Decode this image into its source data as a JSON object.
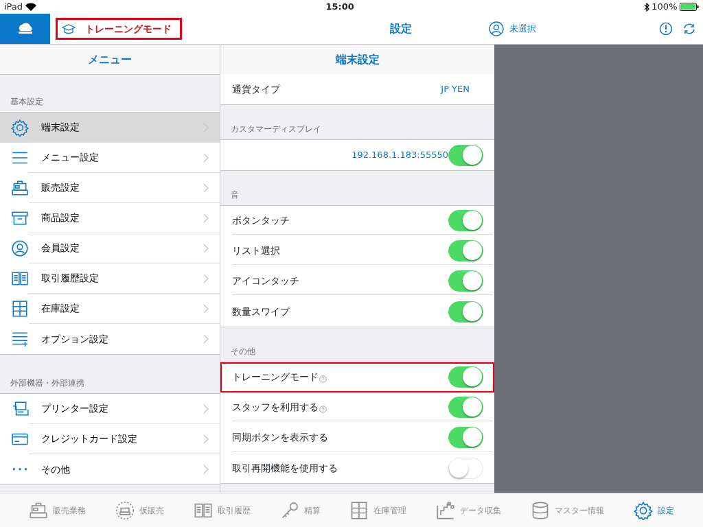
{
  "status_bar": {
    "device": "iPad",
    "time": "15:00",
    "battery": "100%"
  },
  "header": {
    "training_mode": {
      "label": "トレーニングモード",
      "highlighted": true
    },
    "title": "設定",
    "user": "未選択"
  },
  "menu": {
    "title": "メニュー",
    "sections": [
      {
        "header": "基本設定",
        "items": [
          {
            "label": "端末設定",
            "kind": "gear",
            "selected": true
          },
          {
            "label": "メニュー設定",
            "kind": "lines",
            "selected": false
          },
          {
            "label": "販売設定",
            "kind": "register",
            "selected": false
          },
          {
            "label": "商品設定",
            "kind": "box",
            "selected": false
          },
          {
            "label": "会員設定",
            "kind": "person",
            "selected": false
          },
          {
            "label": "取引履歴設定",
            "kind": "book",
            "selected": false
          },
          {
            "label": "在庫設定",
            "kind": "drawers",
            "selected": false
          },
          {
            "label": "オプション設定",
            "kind": "listplus",
            "selected": false
          }
        ]
      },
      {
        "header": "外部機器・外部連携",
        "items": [
          {
            "label": "プリンター設定",
            "kind": "printer",
            "selected": false
          },
          {
            "label": "クレジットカード設定",
            "kind": "card",
            "selected": false
          },
          {
            "label": "その他",
            "kind": "dots",
            "selected": false
          }
        ]
      }
    ]
  },
  "detail": {
    "title": "端末設定",
    "groups": [
      {
        "rows": [
          {
            "kind": "value",
            "label": "通貨タイプ",
            "value": "JP YEN"
          }
        ]
      },
      {
        "header": "カスタマーディスプレイ",
        "rows": [
          {
            "kind": "toggle",
            "value": "192.168.1.183:55550",
            "on": true,
            "highlighted": false,
            "help": false
          }
        ]
      },
      {
        "header": "音",
        "rows": [
          {
            "kind": "toggle",
            "label": "ボタンタッチ",
            "on": true,
            "highlighted": false,
            "help": false
          },
          {
            "kind": "toggle",
            "label": "リスト選択",
            "on": true,
            "highlighted": false,
            "help": false
          },
          {
            "kind": "toggle",
            "label": "アイコンタッチ",
            "on": true,
            "highlighted": false,
            "help": false
          },
          {
            "kind": "toggle",
            "label": "数量スワイプ",
            "on": true,
            "highlighted": false,
            "help": false
          }
        ]
      },
      {
        "header": "その他",
        "rows": [
          {
            "kind": "toggle",
            "label": "トレーニングモード",
            "on": true,
            "highlighted": true,
            "help": true
          },
          {
            "kind": "toggle",
            "label": "スタッフを利用する",
            "on": true,
            "highlighted": false,
            "help": true
          },
          {
            "kind": "toggle",
            "label": "同期ボタンを表示する",
            "on": true,
            "highlighted": false,
            "help": false
          },
          {
            "kind": "toggle",
            "label": "取引再開機能を使用する",
            "on": false,
            "highlighted": false,
            "help": false
          }
        ]
      }
    ]
  },
  "tab_bar": [
    {
      "label": "販売業務",
      "kind": "register",
      "selected": false
    },
    {
      "label": "仮販売",
      "kind": "dashregister",
      "selected": false
    },
    {
      "label": "取引履歴",
      "kind": "book",
      "selected": false
    },
    {
      "label": "精算",
      "kind": "key",
      "selected": false
    },
    {
      "label": "在庫管理",
      "kind": "drawers",
      "selected": false
    },
    {
      "label": "データ収集",
      "kind": "chart",
      "selected": false
    },
    {
      "label": "マスター情報",
      "kind": "database",
      "selected": false
    },
    {
      "label": "設定",
      "kind": "gear",
      "selected": true
    }
  ]
}
